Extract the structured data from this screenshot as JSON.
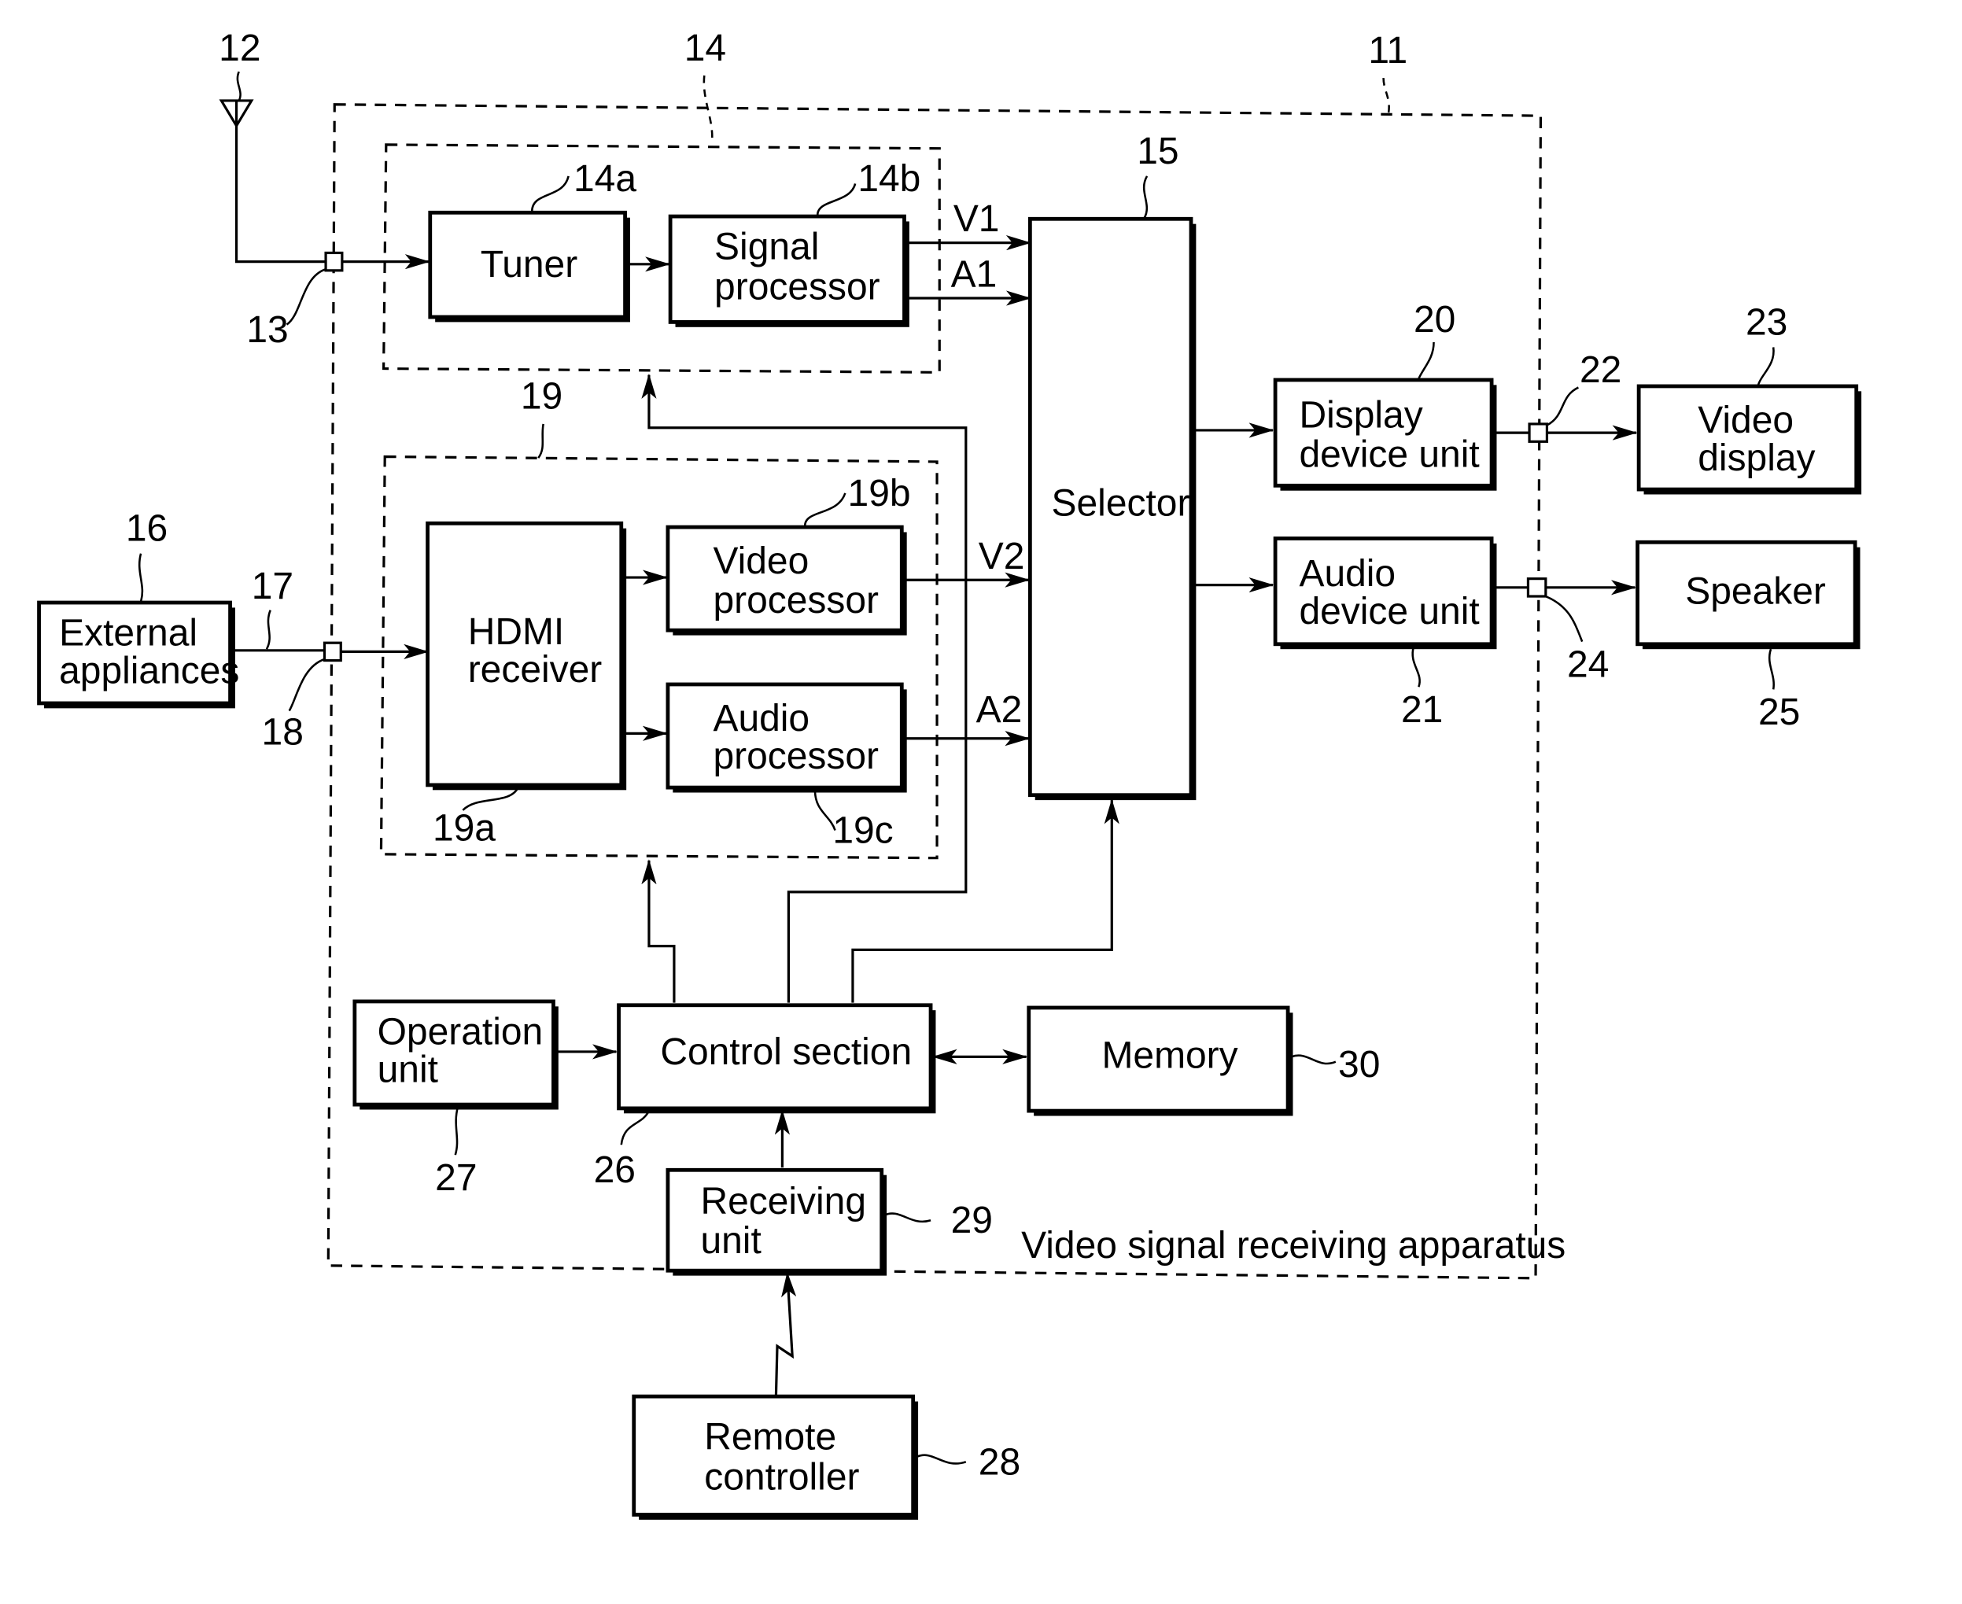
{
  "diagram": {
    "title": "Video signal receiving apparatus",
    "ref_numbers": {
      "apparatus": "11",
      "antenna": "12",
      "antenna_terminal": "13",
      "tuner_group": "14",
      "tuner": "14a",
      "signal_processor": "14b",
      "selector": "15",
      "external_appliances": "16",
      "hdmi_cable": "17",
      "hdmi_terminal": "18",
      "hdmi_group": "19",
      "hdmi_receiver": "19a",
      "video_processor": "19b",
      "audio_processor": "19c",
      "display_device_unit": "20",
      "audio_device_unit": "21",
      "video_out_terminal": "22",
      "video_display": "23",
      "audio_out_terminal": "24",
      "speaker": "25",
      "control_section": "26",
      "operation_unit": "27",
      "remote_controller": "28",
      "receiving_unit": "29",
      "memory": "30"
    },
    "blocks": {
      "tuner": [
        "Tuner"
      ],
      "signal_processor": [
        "Signal",
        "processor"
      ],
      "selector": [
        "Selector"
      ],
      "external_appliances": [
        "External",
        "appliances"
      ],
      "hdmi_receiver": [
        "HDMI",
        "receiver"
      ],
      "video_processor": [
        "Video",
        "processor"
      ],
      "audio_processor": [
        "Audio",
        "processor"
      ],
      "display_device_unit": [
        "Display",
        "device  unit"
      ],
      "audio_device_unit": [
        "Audio",
        "device  unit"
      ],
      "video_display": [
        "Video",
        "display"
      ],
      "speaker": [
        "Speaker"
      ],
      "operation_unit": [
        "Operation",
        "unit"
      ],
      "control_section": [
        "Control  section"
      ],
      "memory": [
        "Memory"
      ],
      "receiving_unit": [
        "Receiving",
        "unit"
      ],
      "remote_controller": [
        "Remote",
        "controller"
      ]
    },
    "signals": {
      "v1": "V1",
      "a1": "A1",
      "v2": "V2",
      "a2": "A2"
    }
  }
}
